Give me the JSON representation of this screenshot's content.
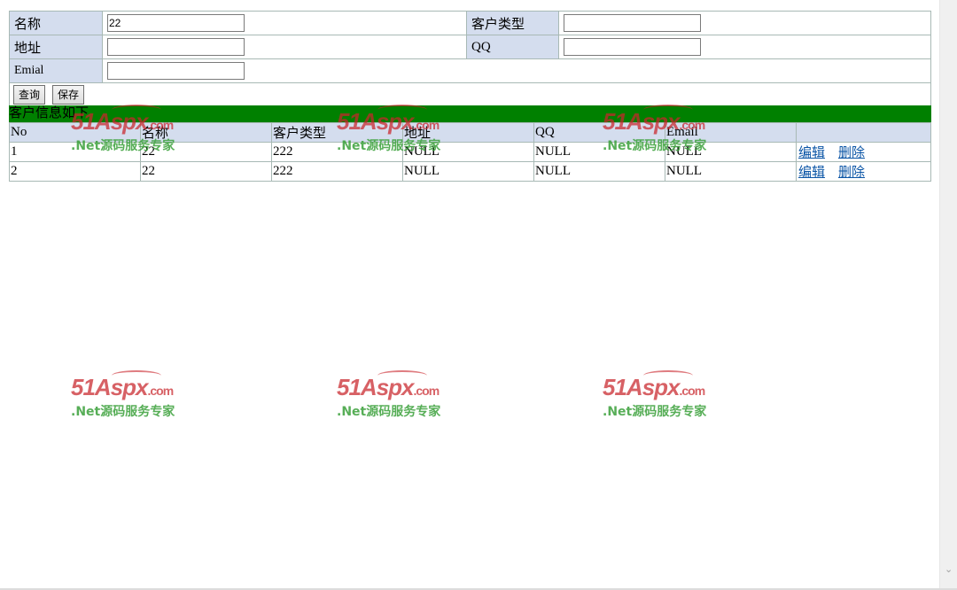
{
  "form": {
    "name_label": "名称",
    "name_value": "22",
    "type_label": "客户类型",
    "type_value": "",
    "address_label": "地址",
    "address_value": "",
    "qq_label": "QQ",
    "qq_value": "",
    "email_label": "Emial",
    "email_value": "",
    "query_button": "查询",
    "save_button": "保存"
  },
  "section_title": "客户信息如下",
  "grid": {
    "headers": [
      "No",
      "名称",
      "客户类型",
      "地址",
      "QQ",
      "Email",
      ""
    ],
    "rows": [
      {
        "no": "1",
        "name": "22",
        "type": "222",
        "address": "NULL",
        "qq": "NULL",
        "email": "NULL",
        "edit": "编辑",
        "delete": "删除"
      },
      {
        "no": "2",
        "name": "22",
        "type": "222",
        "address": "NULL",
        "qq": "NULL",
        "email": "NULL",
        "edit": "编辑",
        "delete": "删除"
      }
    ]
  },
  "watermark": {
    "logo": "51Aspx",
    "domain": ".com",
    "tagline": ".Net源码服务专家"
  },
  "colors": {
    "label_bg": "#d4ddee",
    "title_bar": "#008000",
    "link": "#0b55a6"
  }
}
